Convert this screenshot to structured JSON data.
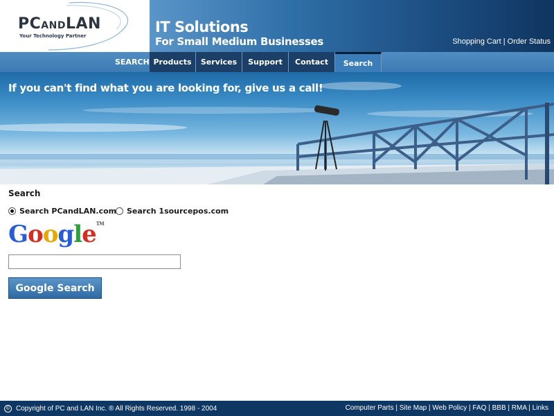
{
  "header": {
    "logo_text_a": "PC",
    "logo_text_and": "AND",
    "logo_text_b": "LAN",
    "logo_tagline": "Your Technology Partner",
    "title_line1": "IT Solutions",
    "title_line2": "For Small Medium Businesses",
    "links": [
      "Shopping Cart",
      "Order Status"
    ]
  },
  "nav": {
    "search_label": "SEARCH",
    "tabs": [
      {
        "label": "Products"
      },
      {
        "label": "Services"
      },
      {
        "label": "Support"
      },
      {
        "label": "Contact"
      },
      {
        "label": "Search",
        "active": true
      }
    ]
  },
  "hero": {
    "text": "If you can't find what you are looking for, give us a call!"
  },
  "search": {
    "heading": "Search",
    "options": [
      {
        "label": "Search PCandLAN.com",
        "checked": true
      },
      {
        "label": "Search 1sourcepos.com",
        "checked": false
      }
    ],
    "google_letters": [
      "G",
      "o",
      "o",
      "g",
      "l",
      "e"
    ],
    "google_tm": "TM",
    "input_value": "",
    "button_label": "Google Search"
  },
  "footer": {
    "copyright_symbol": "©",
    "copyright": "Copyright of PC and LAN Inc. ® All Rights Reserved. 1998 - 2004",
    "links": [
      "Computer Parts",
      "Site Map",
      "Web Policy",
      "FAQ",
      "BBB",
      "RMA",
      "Links"
    ]
  },
  "colors": {
    "nav_tab": "#1b3f66",
    "nav_active": "#3b7db8",
    "footer": "#0f3763",
    "google_blue": "#2a5bd7",
    "google_red": "#d62d20",
    "google_yellow": "#e8a800",
    "google_green": "#2e9e3f"
  }
}
